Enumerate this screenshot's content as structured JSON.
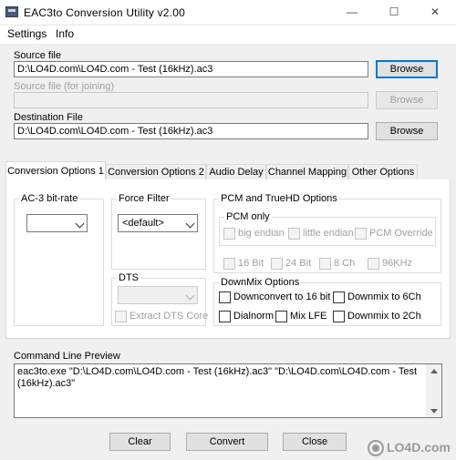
{
  "window": {
    "title": "EAC3to Conversion Utility   v2.00",
    "minimize": "—",
    "maximize": "☐",
    "close": "✕"
  },
  "menu": {
    "settings": "Settings",
    "info": "Info"
  },
  "source": {
    "label": "Source file",
    "value": "D:\\LO4D.com\\LO4D.com - Test (16kHz).ac3",
    "browse": "Browse"
  },
  "join": {
    "label": "Source file (for joining)",
    "value": "",
    "browse": "Browse"
  },
  "destination": {
    "label": "Destination File",
    "value": "D:\\LO4D.com\\LO4D.com - Test (16kHz).ac3",
    "browse": "Browse"
  },
  "tabs": [
    "Conversion Options 1",
    "Conversion Options 2",
    "Audio Delay",
    "Channel Mapping",
    "Other Options"
  ],
  "ac3": {
    "title": "AC-3 bit-rate",
    "selected": ""
  },
  "force_filter": {
    "title": "Force Filter",
    "selected": "<default>"
  },
  "dts": {
    "title": "DTS",
    "selected": "",
    "extract_core": "Extract DTS Core"
  },
  "pcm": {
    "title": "PCM and TrueHD Options",
    "pcm_only_title": "PCM only",
    "big_endian": "big endian",
    "little_endian": "little endian",
    "pcm_override": "PCM Override",
    "bit16": "16 Bit",
    "bit24": "24 Bit",
    "ch8": "8 Ch",
    "khz96": "96KHz"
  },
  "downmix": {
    "title": "DownMix Options",
    "downconvert16": "Downconvert to 16 bit",
    "downmix6": "Downmix to 6Ch",
    "dialnorm": "Dialnorm",
    "mixlfe": "Mix LFE",
    "downmix2": "Downmix to 2Ch"
  },
  "preview": {
    "label": "Command Line Preview",
    "text": "eac3to.exe \"D:\\LO4D.com\\LO4D.com - Test (16kHz).ac3\"  \"D:\\LO4D.com\\LO4D.com - Test (16kHz).ac3\""
  },
  "actions": {
    "clear": "Clear",
    "convert": "Convert",
    "close": "Close"
  },
  "watermark": {
    "text": "LO4D.com"
  }
}
